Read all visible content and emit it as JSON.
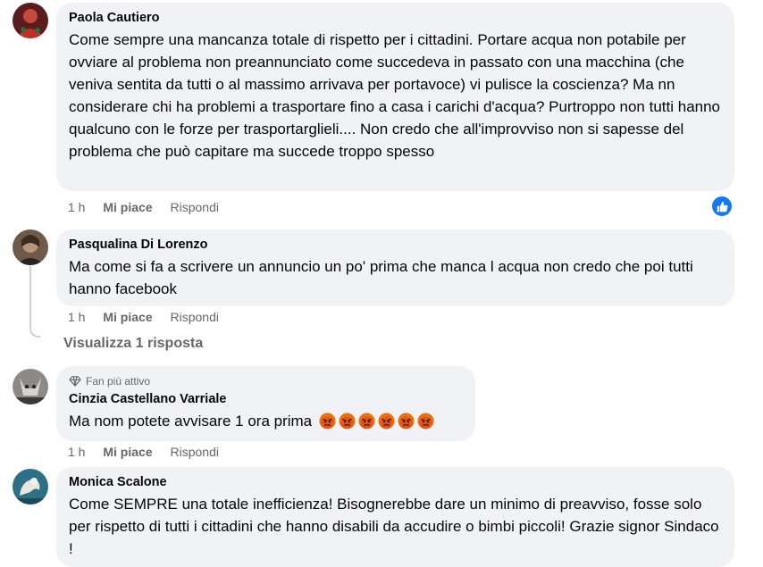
{
  "comments": [
    {
      "author": "Paola Cautiero",
      "text": "Come sempre una mancanza totale di rispetto per i cittadini. Portare acqua non potabile per ovviare al problema non preannunciato come succedeva in passato con una macchina (che veniva sentita da tutti o al massimo arrivava per portavoce) vi pulisce la coscienza? Ma nn considerare chi ha problemi a trasportare fino a casa i carichi d'acqua? Purtroppo non tutti hanno qualcuno con le forze per trasportarglieli.... Non credo che all'improvviso non si sapesse del problema che può capitare ma succede troppo spesso",
      "time": "1 h",
      "like": "Mi piace",
      "reply": "Rispondi"
    },
    {
      "author": "Pasqualina Di Lorenzo",
      "text": "Ma come si fa a scrivere un annuncio un po' prima che manca l acqua non credo che poi tutti hanno facebook",
      "time": "1 h",
      "like": "Mi piace",
      "reply": "Rispondi",
      "view_replies": "Visualizza 1 risposta"
    },
    {
      "badge": "Fan più attivo",
      "author": "Cinzia Castellano Varriale",
      "text": "Ma nom potete avvisare 1 ora prima",
      "emoji_count": 6,
      "time": "1 h",
      "like": "Mi piace",
      "reply": "Rispondi"
    },
    {
      "author": "Monica Scalone",
      "text": "Come SEMPRE una totale inefficienza! Bisognerebbe dare un minimo di preavviso, fosse solo per rispetto di tutti i cittadini che hanno disabili da accudire o bimbi piccoli! Grazie signor Sindaco !"
    }
  ],
  "colors": {
    "bubble": "#f0f2f5",
    "meta_text": "#65676b",
    "like_blue": "#1877f2",
    "angry_emoji": "#e9710f"
  }
}
